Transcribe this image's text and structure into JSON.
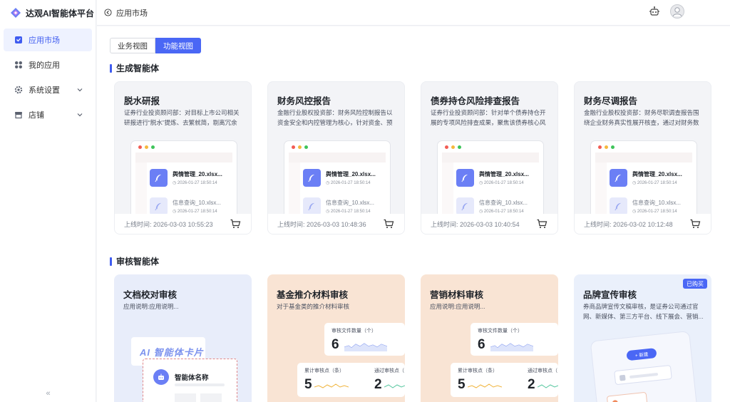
{
  "app": {
    "title": "达观AI智能体平台"
  },
  "sidebar": {
    "items": [
      {
        "label": "应用市场",
        "icon": "store-icon",
        "active": true
      },
      {
        "label": "我的应用",
        "icon": "apps-grid-icon",
        "active": false
      },
      {
        "label": "系统设置",
        "icon": "gear-icon",
        "active": false
      },
      {
        "label": "店铺",
        "icon": "shop-icon",
        "active": false
      }
    ],
    "collapse": "«"
  },
  "topbar": {
    "back_label": "应用市场"
  },
  "view_toggle": {
    "business": "业务视图",
    "function": "功能视图"
  },
  "sections": {
    "generate": "生成智能体",
    "audit": "审核智能体"
  },
  "mock_files": [
    {
      "name": "舆情管理_20.xlsx...",
      "date": "2026-01-27 18:50:14"
    },
    {
      "name": "信息查询_10.xlsx...",
      "date": "2026-01-27 18:50:14"
    }
  ],
  "gen_cards": [
    {
      "title": "脱水研报",
      "desc": "证券行业投资顾问部：对目标上市公司相关研报进行“脱水”提炼、去繁就简，剔离冗余信...",
      "online": "上线时间: 2026-03-03 10:55:23"
    },
    {
      "title": "财务风控报告",
      "desc": "金融行业股权投资部：财务风险控制报告以资金安全和内控管理为核心，针对资金、预算...",
      "online": "上线时间: 2026-03-03 10:48:36"
    },
    {
      "title": "债券持仓风险排查报告",
      "desc": "证券行业投资顾问部：针对单个债券持仓开展的专项风险排查成果，聚焦该债券核心风险...",
      "online": "上线时间: 2026-03-03 10:40:54"
    },
    {
      "title": "财务尽调报告",
      "desc": "金融行业股权投资部：财务尽职调查报告围绕企业财务真实性展开核查，通过对财务数据...",
      "online": "上线时间: 2026-03-02 10:12:48"
    }
  ],
  "audit_cards": [
    {
      "title": "文档校对审核",
      "desc": "应用说明:应用说明...",
      "banner": "AI 智能体卡片",
      "agent_name": "智能体名称",
      "bg": "#e8edfa"
    },
    {
      "title": "基金推介材料审核",
      "desc": "对于基金类的推介材料审核",
      "bg": "#f9e4d4"
    },
    {
      "title": "营销材料审核",
      "desc": "应用说明:应用说明...",
      "bg": "#f9e4d4"
    },
    {
      "title": "品牌宣传审核",
      "desc": "券商品牌宣传文稿审核，是证券公司通过官网、新媒体、第三方平台、线下展会、营销...",
      "badge": "已购买",
      "new_btn": "+ 新建",
      "bg": "#eaf0fb"
    }
  ],
  "audit_stats": {
    "file_count_label": "审核文件数量（个）",
    "file_count": "6",
    "points_label": "累计审核点（条）",
    "points": "5",
    "passed_label": "通过审核点（",
    "passed": "2"
  },
  "colors": {
    "accent": "#4a67f5",
    "brand": "#3f5cf0"
  }
}
